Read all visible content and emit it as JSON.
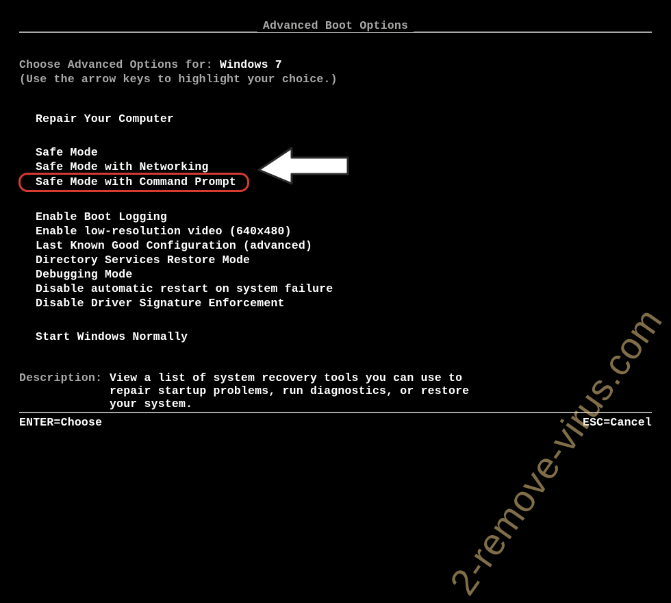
{
  "title": "Advanced Boot Options",
  "choose_prefix": "Choose Advanced Options for: ",
  "os_name": "Windows 7",
  "hint": "(Use the arrow keys to highlight your choice.)",
  "group_repair": {
    "items": [
      "Repair Your Computer"
    ]
  },
  "group_safe": {
    "items": [
      "Safe Mode",
      "Safe Mode with Networking",
      "Safe Mode with Command Prompt"
    ],
    "selected_index": 2
  },
  "group_more": {
    "items": [
      "Enable Boot Logging",
      "Enable low-resolution video (640x480)",
      "Last Known Good Configuration (advanced)",
      "Directory Services Restore Mode",
      "Debugging Mode",
      "Disable automatic restart on system failure",
      "Disable Driver Signature Enforcement"
    ]
  },
  "group_start": {
    "items": [
      "Start Windows Normally"
    ]
  },
  "description_label": "Description:",
  "description_text": "View a list of system recovery tools you can use to repair startup problems, run diagnostics, or restore your system.",
  "footer": {
    "enter": "ENTER=Choose",
    "esc": "ESC=Cancel"
  },
  "watermark": "2-remove-virus.com"
}
